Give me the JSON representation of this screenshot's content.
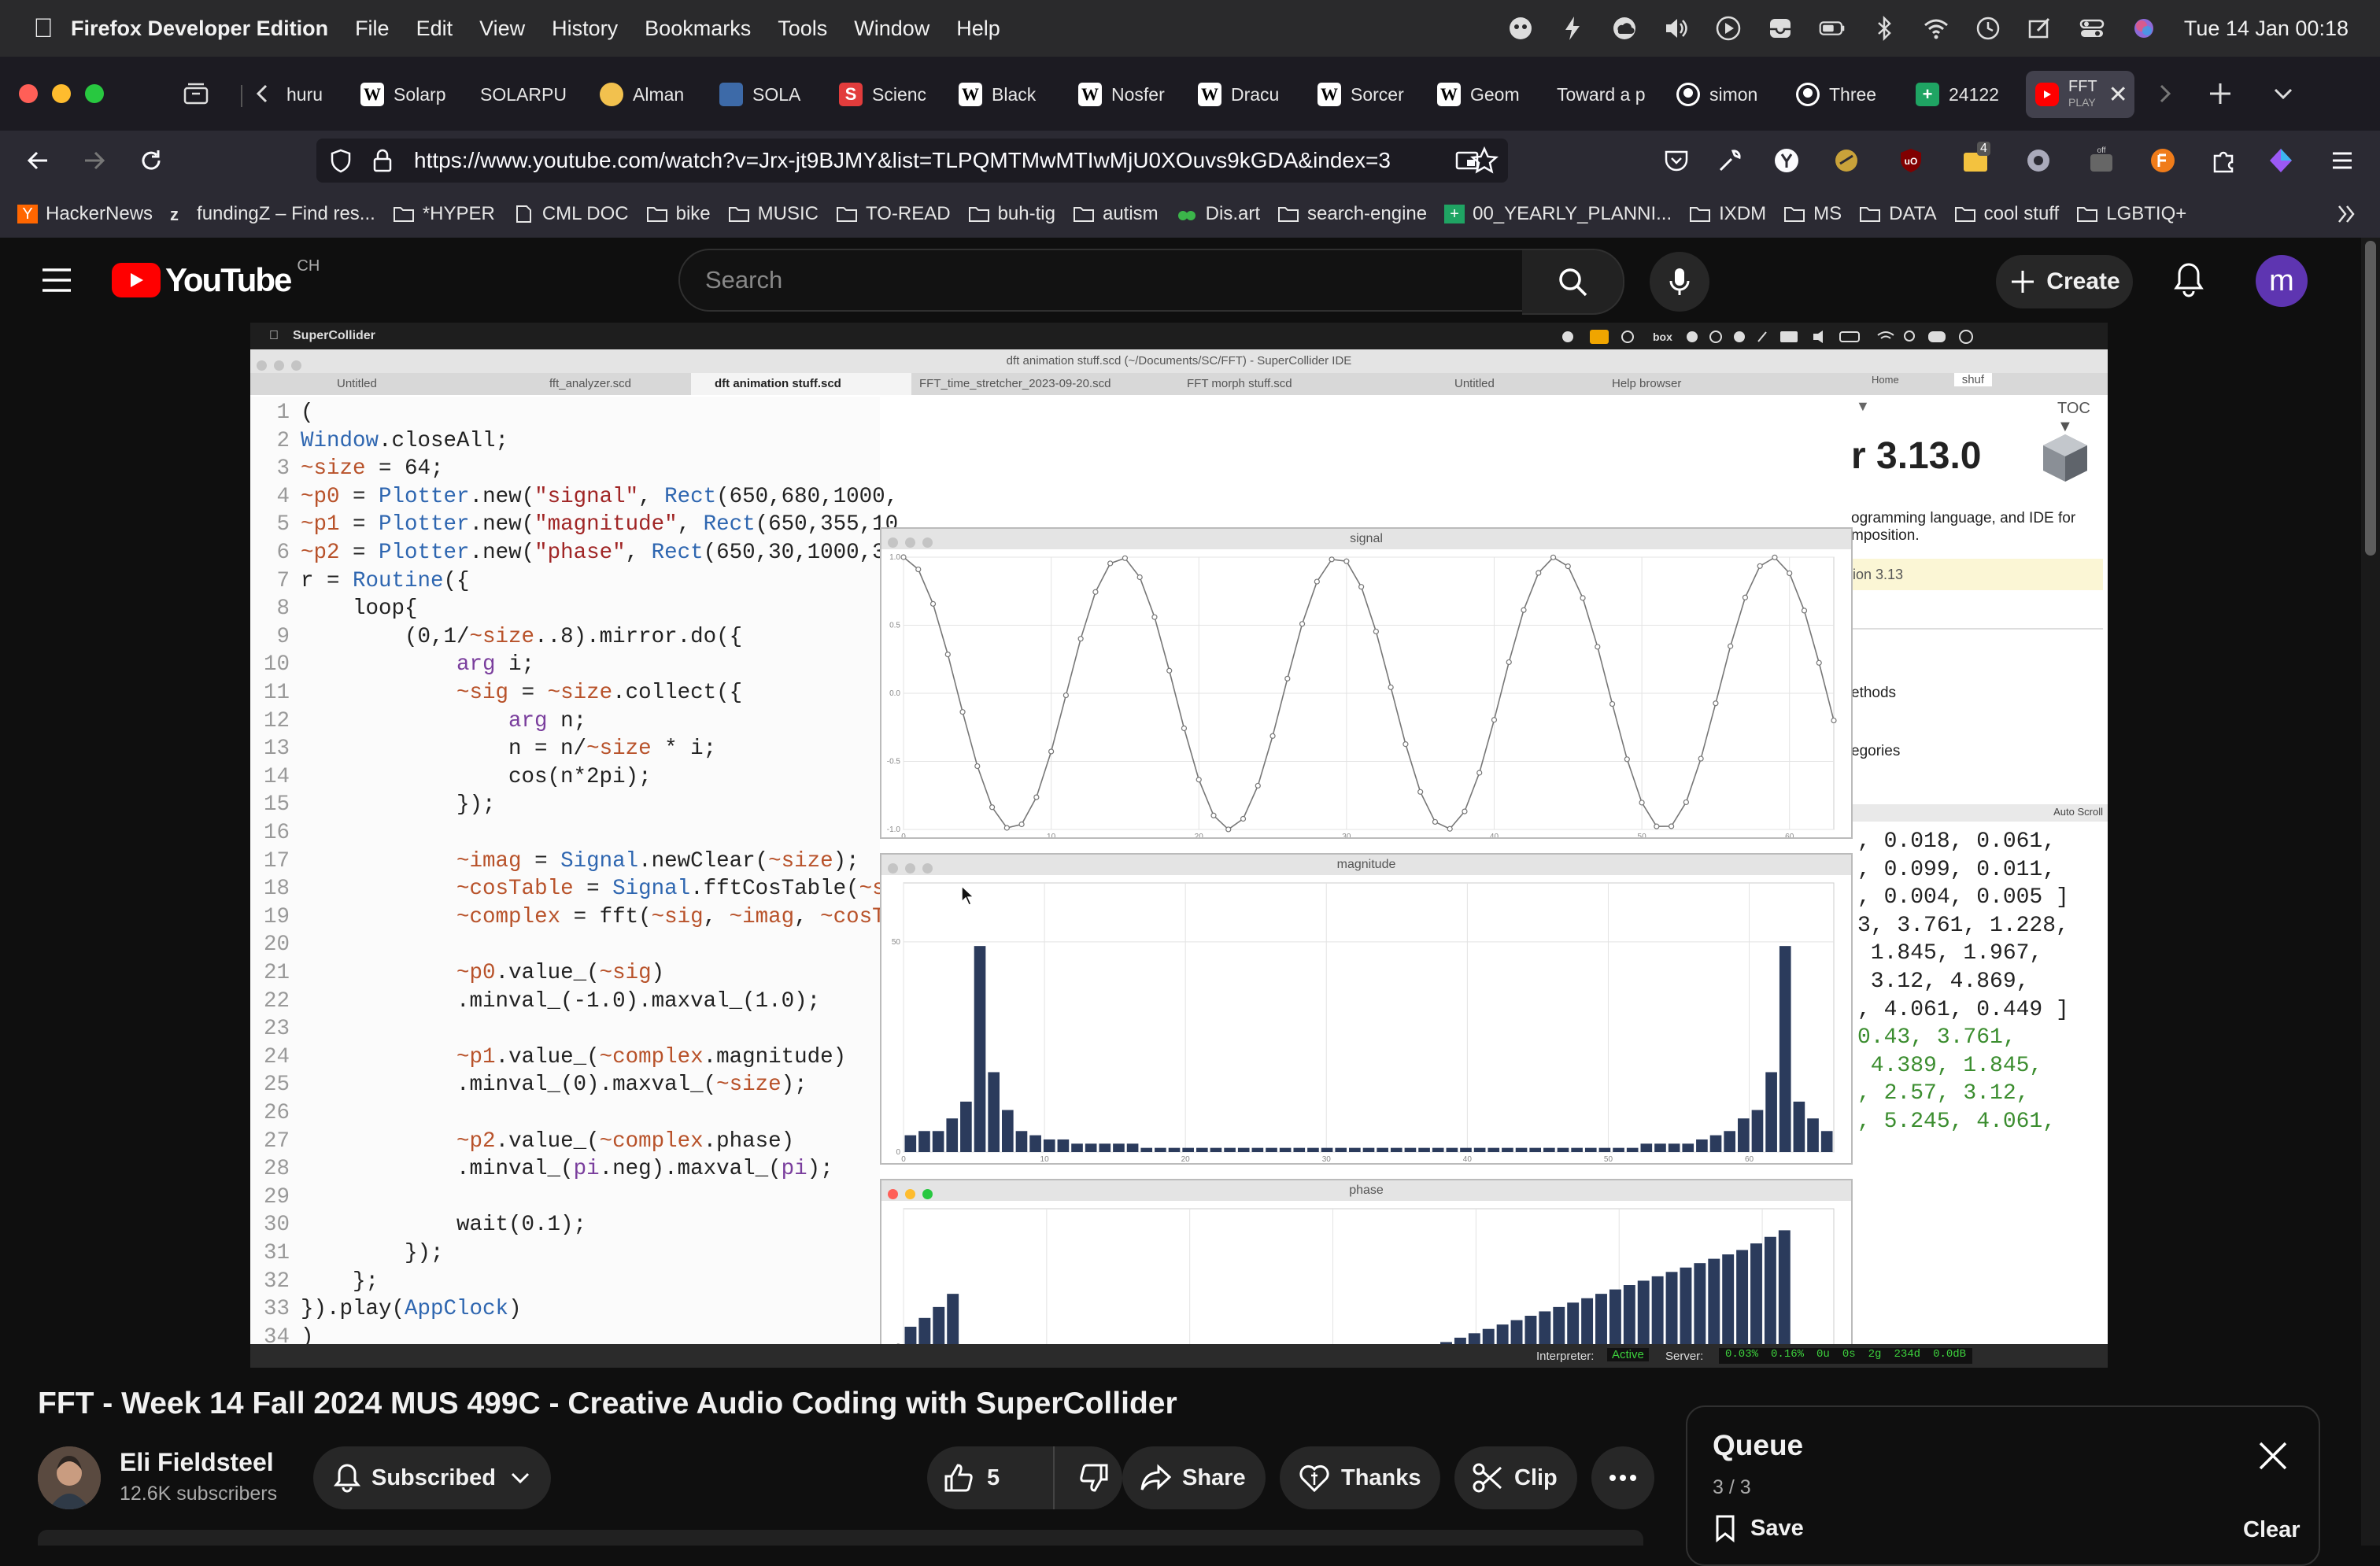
{
  "menubar": {
    "app_name": "Firefox Developer Edition",
    "items": [
      "File",
      "Edit",
      "View",
      "History",
      "Bookmarks",
      "Tools",
      "Window",
      "Help"
    ],
    "clock": "Tue 14 Jan  00:18"
  },
  "tabs": [
    {
      "label": "huru"
    },
    {
      "label": "Solarp",
      "icon": "W"
    },
    {
      "label": "SOLARPU"
    },
    {
      "label": "Alman"
    },
    {
      "label": "SOLA"
    },
    {
      "label": "Scienc"
    },
    {
      "label": "Black",
      "icon": "W"
    },
    {
      "label": "Nosfer",
      "icon": "W"
    },
    {
      "label": "Dracu",
      "icon": "W"
    },
    {
      "label": "Sorcer",
      "icon": "W"
    },
    {
      "label": "Geom",
      "icon": "W"
    },
    {
      "label": "Toward a p"
    },
    {
      "label": "simon"
    },
    {
      "label": "Three"
    },
    {
      "label": "24122"
    },
    {
      "label": "FFT",
      "sublabel": "PLAY"
    }
  ],
  "address_bar": {
    "url": "https://www.youtube.com/watch?v=Jrx-jt9BJMY&list=TLPQMTMwMTIwMjU0XOuvs9kGDA&index=3"
  },
  "toolbar_badges": {
    "extensions_count": "4"
  },
  "bookmarks": [
    "HackerNews",
    "fundingZ – Find res...",
    "*HYPER",
    "CML DOC",
    "bike",
    "MUSIC",
    "TO-READ",
    "buh-tig",
    "autism",
    "Dis.art",
    "search-engine",
    "00_YEARLY_PLANNI...",
    "IXDM",
    "MS",
    "DATA",
    "cool stuff",
    "LGBTIQ+"
  ],
  "youtube": {
    "logo_text": "YouTube",
    "country_code": "CH",
    "search_placeholder": "Search",
    "create_label": "Create",
    "avatar_letter": "m"
  },
  "video_frame": {
    "app_menu": "SuperCollider",
    "ide_title": "dft animation stuff.scd (~/Documents/SC/FFT) - SuperCollider IDE",
    "ide_tabs": [
      "Untitled",
      "fft_analyzer.scd",
      "dft animation stuff.scd",
      "FFT_time_stretcher_2023-09-20.scd",
      "FFT morph stuff.scd",
      "Untitled",
      "Help browser"
    ],
    "help_nav": {
      "home": "Home",
      "search": "shuf",
      "toc": "TOC ▼"
    },
    "help_title": "r 3.13.0",
    "help_desc_1": "ogramming language, and IDE for",
    "help_desc_2": "mposition.",
    "help_version": "ion 3.13",
    "help_link_1": "ethods",
    "help_link_2": "egories",
    "autoscroll": "Auto Scroll",
    "code_lines": [
      "(",
      "Window.closeAll;",
      "~size = 64;",
      "~p0 = Plotter.new(\"signal\", Rect(650,680,1000,",
      "~p1 = Plotter.new(\"magnitude\", Rect(650,355,10",
      "~p2 = Plotter.new(\"phase\", Rect(650,30,1000,30",
      "r = Routine({",
      "    loop{",
      "        (0,1/~size..8).mirror.do({",
      "            arg i;",
      "            ~sig = ~size.collect({",
      "                arg n;",
      "                n = n/~size * i;",
      "                cos(n*2pi);",
      "            });",
      "",
      "            ~imag = Signal.newClear(~size);",
      "            ~cosTable = Signal.fftCosTable(~si",
      "            ~complex = fft(~sig, ~imag, ~cosTa",
      "",
      "            ~p0.value_(~sig)",
      "            .minval_(-1.0).maxval_(1.0);",
      "",
      "            ~p1.value_(~complex.magnitude)",
      "            .minval_(0).maxval_(~size);",
      "",
      "            ~p2.value_(~complex.phase)",
      "            .minval_(pi.neg).maxval_(pi);",
      "",
      "            wait(0.1);",
      "        });",
      "    };",
      "}).play(AppClock)",
      ")",
      ""
    ],
    "post_lines": [
      {
        "text": ", 0.018, 0.061,",
        "color": "black"
      },
      {
        "text": ", 0.099, 0.011,",
        "color": "black"
      },
      {
        "text": ", 0.004, 0.005 ]",
        "color": "black"
      },
      {
        "text": "3, 3.761, 1.228,",
        "color": "black"
      },
      {
        "text": " 1.845, 1.967,",
        "color": "black"
      },
      {
        "text": " 3.12, 4.869,",
        "color": "black"
      },
      {
        "text": ", 4.061, 0.449 ]",
        "color": "black"
      },
      {
        "text": "0.43, 3.761,",
        "color": "green"
      },
      {
        "text": " 4.389, 1.845,",
        "color": "green"
      },
      {
        "text": ", 2.57, 3.12,",
        "color": "green"
      },
      {
        "text": ", 5.245, 4.061,",
        "color": "green"
      }
    ],
    "statusbar": {
      "interpreter_label": "Interpreter:",
      "interpreter_state": "Active",
      "server_label": "Server:",
      "stats": [
        "0.03%",
        "0.16%",
        "0u",
        "0s",
        "2g",
        "234d",
        "0.0dB"
      ]
    }
  },
  "plots": {
    "signal": {
      "title": "signal",
      "y_ticks": [
        "1.0",
        "0.5",
        "0.0",
        "-0.5",
        "-1.0"
      ],
      "x_ticks": [
        "0",
        "10",
        "20",
        "30",
        "40",
        "50",
        "60"
      ]
    },
    "magnitude": {
      "title": "magnitude",
      "y_ticks": [
        "50",
        "0"
      ],
      "x_ticks": [
        "0",
        "10",
        "20",
        "30",
        "40",
        "50",
        "60"
      ]
    },
    "phase": {
      "title": "phase",
      "y_ticks": [
        "0"
      ],
      "x_ticks": [
        "0",
        "10",
        "20",
        "30",
        "40",
        "50",
        "60"
      ]
    }
  },
  "chart_data": [
    {
      "type": "line",
      "title": "signal",
      "x": [
        0,
        63
      ],
      "ylim": [
        -1.0,
        1.0
      ],
      "description_points": "cos(2*pi*n*4.3/64) sampled at 64 points",
      "series": [
        {
          "values_fn": "cosine",
          "cycles": 4.35
        }
      ]
    },
    {
      "type": "bar",
      "title": "magnitude",
      "ylim": [
        0,
        64
      ],
      "values": [
        4,
        5,
        5,
        8,
        12,
        49,
        19,
        10,
        5,
        4,
        3,
        3,
        2,
        2,
        2,
        2,
        2,
        1,
        1,
        1,
        1,
        1,
        1,
        1,
        1,
        1,
        1,
        1,
        1,
        1,
        1,
        1,
        1,
        1,
        1,
        1,
        1,
        1,
        1,
        1,
        1,
        1,
        1,
        1,
        1,
        1,
        1,
        1,
        1,
        1,
        1,
        1,
        1,
        2,
        2,
        2,
        2,
        3,
        4,
        5,
        8,
        10,
        19,
        49,
        12,
        8,
        5
      ]
    },
    {
      "type": "bar",
      "title": "phase",
      "ylim": [
        -3.1416,
        3.1416
      ],
      "values": [
        0.45,
        0.65,
        0.9,
        1.2,
        -3.0,
        -2.85,
        -2.8,
        -2.75,
        -2.7,
        -2.65,
        -2.6,
        -2.55,
        -2.5,
        -2.45,
        -2.4,
        -2.3,
        -2.2,
        -2.1,
        -2.0,
        -1.9,
        -1.8,
        -1.7,
        -1.6,
        -1.5,
        -1.4,
        -1.3,
        -1.2,
        -1.1,
        -1.0,
        -0.9,
        -0.8,
        -0.7,
        -0.6,
        -0.5,
        -0.4,
        -0.3,
        -0.2,
        -0.1,
        0.1,
        0.2,
        0.3,
        0.4,
        0.5,
        0.6,
        0.7,
        0.8,
        0.9,
        1.0,
        1.1,
        1.2,
        1.3,
        1.4,
        1.5,
        1.6,
        1.7,
        1.8,
        1.9,
        2.0,
        2.1,
        2.2,
        2.35,
        2.5,
        2.65,
        -1.15,
        -0.9,
        -0.7
      ]
    }
  ],
  "video_info": {
    "title": "FFT - Week 14 Fall 2024 MUS 499C - Creative Audio Coding with SuperCollider",
    "channel": "Eli Fieldsteel",
    "subscribers": "12.6K subscribers",
    "subscribed_label": "Subscribed",
    "likes": "5",
    "share_label": "Share",
    "thanks_label": "Thanks",
    "clip_label": "Clip"
  },
  "queue": {
    "title": "Queue",
    "position": "3 / 3",
    "save_label": "Save",
    "clear_label": "Clear"
  },
  "colors": {
    "youtube_red": "#ff0000",
    "bar_color": "#2b3b5c",
    "active_green": "#3b8d2f"
  }
}
